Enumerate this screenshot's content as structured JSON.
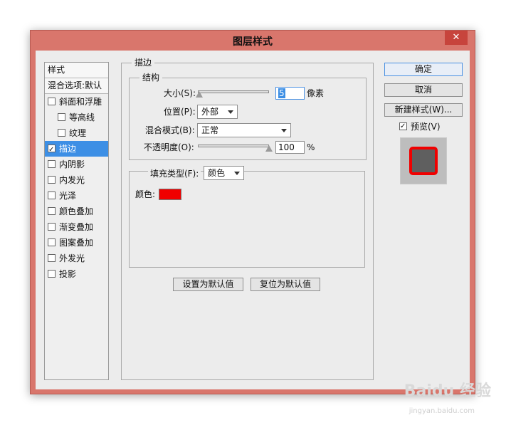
{
  "window": {
    "title": "图层样式",
    "close": "✕"
  },
  "styles_panel": {
    "header": "样式",
    "blend_options": "混合选项:默认",
    "items": [
      {
        "label": "斜面和浮雕",
        "checked": false
      },
      {
        "label": "等高线",
        "checked": false
      },
      {
        "label": "纹理",
        "checked": false
      },
      {
        "label": "描边",
        "checked": true
      },
      {
        "label": "内阴影",
        "checked": false
      },
      {
        "label": "内发光",
        "checked": false
      },
      {
        "label": "光泽",
        "checked": false
      },
      {
        "label": "颜色叠加",
        "checked": false
      },
      {
        "label": "渐变叠加",
        "checked": false
      },
      {
        "label": "图案叠加",
        "checked": false
      },
      {
        "label": "外发光",
        "checked": false
      },
      {
        "label": "投影",
        "checked": false
      }
    ]
  },
  "stroke": {
    "group_title": "描边",
    "structure_title": "结构",
    "size_label": "大小(S):",
    "size_value": "5",
    "size_unit": "像素",
    "size_fraction": 0.02,
    "position_label": "位置(P):",
    "position_value": "外部",
    "blend_label": "混合模式(B):",
    "blend_value": "正常",
    "opacity_label": "不透明度(O):",
    "opacity_value": "100",
    "opacity_unit": "%",
    "opacity_fraction": 1.0,
    "fill_type_label": "填充类型(F):",
    "fill_type_value": "颜色",
    "color_label": "颜色:",
    "color_value": "#f00000",
    "make_default": "设置为默认值",
    "reset_default": "复位为默认值"
  },
  "buttons": {
    "ok": "确定",
    "cancel": "取消",
    "new_style": "新建样式(W)...",
    "preview_label": "预览(V)",
    "preview_checked": true
  },
  "preview": {
    "fill_color": "#5f5f5f",
    "stroke_color": "#f00000"
  },
  "watermark": {
    "brand": "Baidu 经验",
    "url": "jingyan.baidu.com"
  }
}
